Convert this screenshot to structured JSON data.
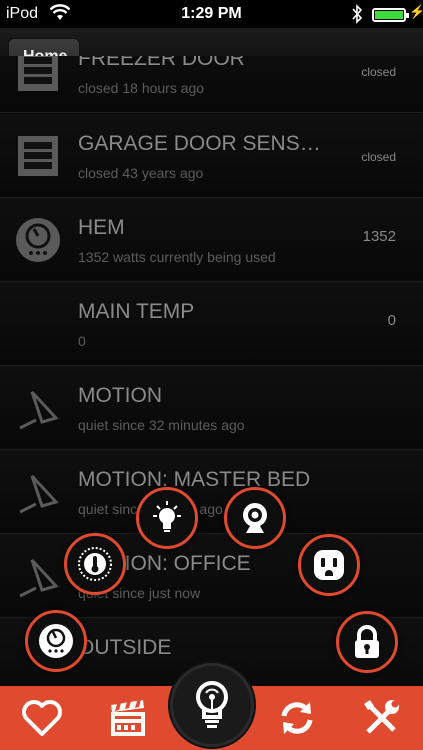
{
  "status_bar": {
    "carrier": "iPod",
    "time": "1:29 PM"
  },
  "nav": {
    "home_label": "Home"
  },
  "devices": [
    {
      "title": "FREEZER DOOR",
      "subtitle": "closed 18 hours ago",
      "value": "closed",
      "icon": "door-icon"
    },
    {
      "title": "GARAGE DOOR SENS…",
      "subtitle": "closed 43 years ago",
      "value": "closed",
      "icon": "door-icon"
    },
    {
      "title": "HEM",
      "subtitle": "1352 watts currently being used",
      "value": "1352",
      "icon": "meter-icon"
    },
    {
      "title": "MAIN TEMP",
      "subtitle": "0",
      "value": "0",
      "icon": ""
    },
    {
      "title": "MOTION",
      "subtitle": "quiet since 32 minutes ago",
      "value": "",
      "icon": "motion-sensor-icon"
    },
    {
      "title": "MOTION: MASTER BED",
      "subtitle": "quiet since 4 hours ago",
      "value": "",
      "icon": "motion-sensor-icon"
    },
    {
      "title": "MOTION: OFFICE",
      "subtitle": "quiet since just now",
      "value": "",
      "icon": "motion-sensor-icon"
    },
    {
      "title": "OUTSIDE",
      "subtitle": "",
      "value": "",
      "icon": ""
    }
  ],
  "colors": {
    "accent": "#e04a2e",
    "battery": "#3ddc3d"
  },
  "tabs": [
    "heart-icon",
    "clapperboard-icon",
    "refresh-icon",
    "tools-icon"
  ]
}
